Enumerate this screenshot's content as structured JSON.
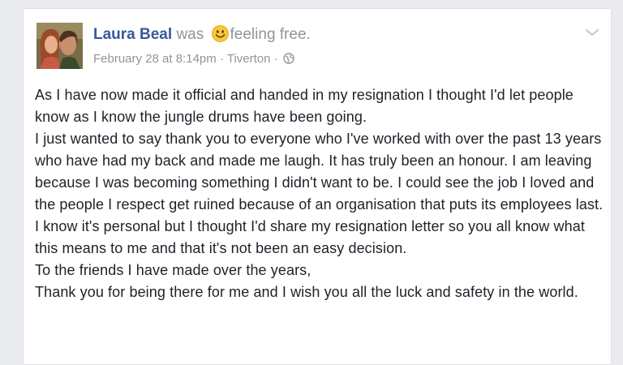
{
  "post": {
    "author": "Laura Beal",
    "was": "was",
    "feeling_emoji": "smiley-emoji",
    "feeling": "feeling free.",
    "date": "February 28 at 8:14pm",
    "separator": "·",
    "location": "Tiverton",
    "privacy_icon": "globe-icon",
    "menu_icon": "chevron-down-icon",
    "paragraphs": [
      "As I have now made it official and handed in my resignation I thought I'd let people know as I know the jungle drums have been going.",
      "I just wanted to say thank you to everyone who I've worked with over the past 13 years who have had my back and made me laugh. It has truly been an honour. I am leaving because I was becoming something I didn't want to be. I could see the job I loved and the people I respect get ruined because of an organisation that puts its employees last. I know it's personal but I thought I'd share my resignation letter so you all know what this means to me and that it's not been an easy decision.",
      "To the friends I have made over the years,",
      "Thank you for being there for me and I wish you all the luck and safety in the world."
    ]
  },
  "colors": {
    "author_link": "#365899",
    "meta_text": "#90949c",
    "body_text": "#1d2129",
    "card_bg": "#ffffff",
    "page_bg": "#e9ebee"
  }
}
